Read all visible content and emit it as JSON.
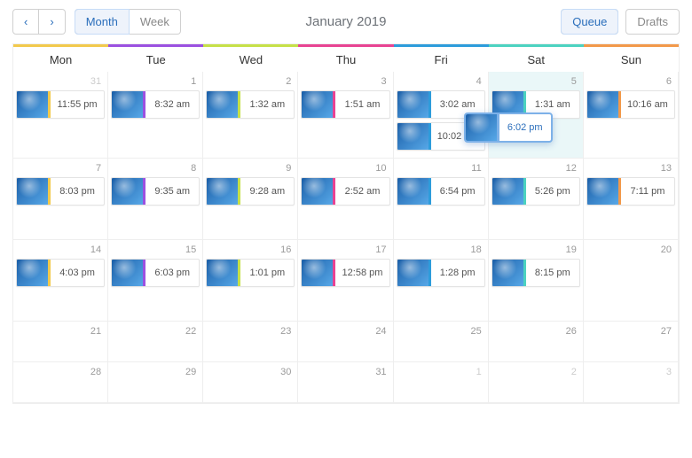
{
  "header": {
    "prev_label": "‹",
    "next_label": "›",
    "month_label": "Month",
    "week_label": "Week",
    "title": "January 2019",
    "queue_label": "Queue",
    "drafts_label": "Drafts"
  },
  "day_headers": [
    {
      "label": "Mon",
      "color": "#f2c94c"
    },
    {
      "label": "Tue",
      "color": "#9b51e0"
    },
    {
      "label": "Wed",
      "color": "#c6e048"
    },
    {
      "label": "Thu",
      "color": "#e84393"
    },
    {
      "label": "Fri",
      "color": "#2d9cdb"
    },
    {
      "label": "Sat",
      "color": "#4cd2c0"
    },
    {
      "label": "Sun",
      "color": "#f2994a"
    }
  ],
  "weeks": [
    {
      "days": [
        {
          "date": "31",
          "muted": true,
          "events": [
            {
              "time": "11:55 pm",
              "color": "#f2c94c"
            }
          ]
        },
        {
          "date": "1",
          "events": [
            {
              "time": "8:32 am",
              "color": "#9b51e0"
            }
          ]
        },
        {
          "date": "2",
          "events": [
            {
              "time": "1:32 am",
              "color": "#c6e048"
            }
          ]
        },
        {
          "date": "3",
          "events": [
            {
              "time": "1:51 am",
              "color": "#e84393"
            }
          ]
        },
        {
          "date": "4",
          "events": [
            {
              "time": "3:02 am",
              "color": "#2d9cdb"
            },
            {
              "time": "10:02 am",
              "color": "#2d9cdb"
            }
          ]
        },
        {
          "date": "5",
          "today": true,
          "events": [
            {
              "time": "1:31 am",
              "color": "#4cd2c0"
            }
          ],
          "dragging_event": {
            "time": "6:02 pm"
          }
        },
        {
          "date": "6",
          "events": [
            {
              "time": "10:16 am",
              "color": "#f2994a"
            }
          ]
        }
      ]
    },
    {
      "days": [
        {
          "date": "7",
          "events": [
            {
              "time": "8:03 pm",
              "color": "#f2c94c"
            }
          ]
        },
        {
          "date": "8",
          "events": [
            {
              "time": "9:35 am",
              "color": "#9b51e0"
            }
          ]
        },
        {
          "date": "9",
          "events": [
            {
              "time": "9:28 am",
              "color": "#c6e048"
            }
          ]
        },
        {
          "date": "10",
          "events": [
            {
              "time": "2:52 am",
              "color": "#e84393"
            }
          ]
        },
        {
          "date": "11",
          "events": [
            {
              "time": "6:54 pm",
              "color": "#2d9cdb"
            }
          ]
        },
        {
          "date": "12",
          "events": [
            {
              "time": "5:26 pm",
              "color": "#4cd2c0"
            }
          ]
        },
        {
          "date": "13",
          "events": [
            {
              "time": "7:11 pm",
              "color": "#f2994a"
            }
          ]
        }
      ]
    },
    {
      "days": [
        {
          "date": "14",
          "events": [
            {
              "time": "4:03 pm",
              "color": "#f2c94c"
            }
          ]
        },
        {
          "date": "15",
          "events": [
            {
              "time": "6:03 pm",
              "color": "#9b51e0"
            }
          ]
        },
        {
          "date": "16",
          "events": [
            {
              "time": "1:01 pm",
              "color": "#c6e048"
            }
          ]
        },
        {
          "date": "17",
          "events": [
            {
              "time": "12:58 pm",
              "color": "#e84393"
            }
          ]
        },
        {
          "date": "18",
          "events": [
            {
              "time": "1:28 pm",
              "color": "#2d9cdb"
            }
          ]
        },
        {
          "date": "19",
          "events": [
            {
              "time": "8:15 pm",
              "color": "#4cd2c0"
            }
          ]
        },
        {
          "date": "20",
          "events": []
        }
      ]
    },
    {
      "short": true,
      "days": [
        {
          "date": "21",
          "events": []
        },
        {
          "date": "22",
          "events": []
        },
        {
          "date": "23",
          "events": []
        },
        {
          "date": "24",
          "events": []
        },
        {
          "date": "25",
          "events": []
        },
        {
          "date": "26",
          "events": []
        },
        {
          "date": "27",
          "events": []
        }
      ]
    },
    {
      "short": true,
      "days": [
        {
          "date": "28",
          "events": []
        },
        {
          "date": "29",
          "events": []
        },
        {
          "date": "30",
          "events": []
        },
        {
          "date": "31",
          "events": []
        },
        {
          "date": "1",
          "muted": true,
          "events": []
        },
        {
          "date": "2",
          "muted": true,
          "events": []
        },
        {
          "date": "3",
          "muted": true,
          "events": []
        }
      ]
    }
  ]
}
